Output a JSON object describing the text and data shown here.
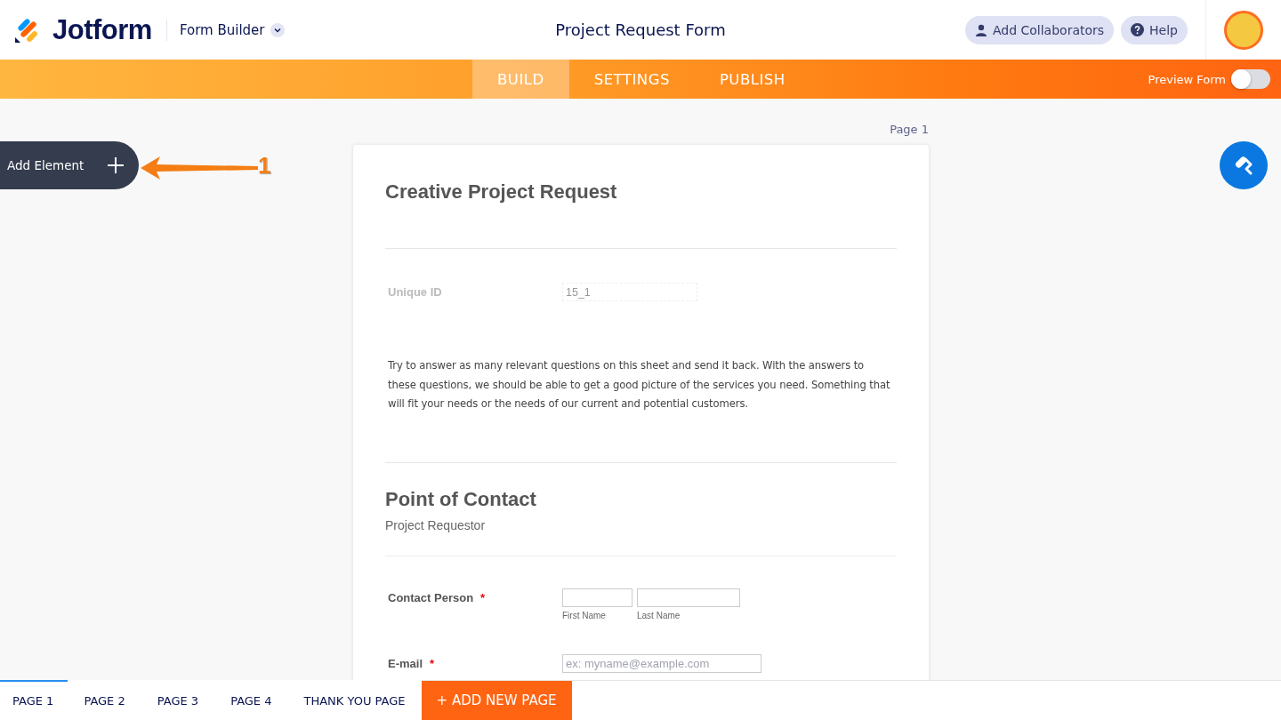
{
  "header": {
    "logo_text": "Jotform",
    "product": "Form Builder",
    "title": "Project Request Form",
    "buttons": [
      {
        "kind": "collaborators",
        "label": "Add Collaborators"
      },
      {
        "kind": "help",
        "label": "Help"
      }
    ]
  },
  "nav": {
    "tabs": [
      {
        "label": "BUILD",
        "selected": true
      },
      {
        "label": "SETTINGS",
        "selected": false
      },
      {
        "label": "PUBLISH",
        "selected": false
      }
    ],
    "preview": {
      "label": "Preview Form",
      "on": false
    }
  },
  "canvas": {
    "page_label": "Page 1",
    "add_element": "Add Element",
    "annotation": "1"
  },
  "form": {
    "items": [
      {
        "kind": "title",
        "text": "Creative Project Request"
      },
      {
        "kind": "textbox",
        "label": "Unique ID",
        "value": "15_1",
        "disabled": true
      },
      {
        "kind": "paragraph",
        "text": "Try to answer as many relevant questions on this sheet and send it back. With the answers to these questions, we should be able to get a good picture of the services you need. Something that will fit your needs or the needs of our current and potential customers."
      },
      {
        "kind": "section",
        "text": "Point of Contact",
        "subtitle": "Project Requestor"
      },
      {
        "kind": "name",
        "label": "Contact Person",
        "required_mark": "*",
        "sublabels": [
          "First Name",
          "Last Name"
        ]
      },
      {
        "kind": "email",
        "label": "E-mail",
        "required_mark": "*",
        "placeholder": "ex: myname@example.com"
      }
    ]
  },
  "pages": {
    "tabs": [
      {
        "label": "PAGE 1",
        "selected": true
      },
      {
        "label": "PAGE 2",
        "selected": false
      },
      {
        "label": "PAGE 3",
        "selected": false
      },
      {
        "label": "PAGE 4",
        "selected": false
      },
      {
        "label": "THANK YOU PAGE",
        "selected": false
      }
    ],
    "add_page": "+ ADD NEW PAGE"
  }
}
